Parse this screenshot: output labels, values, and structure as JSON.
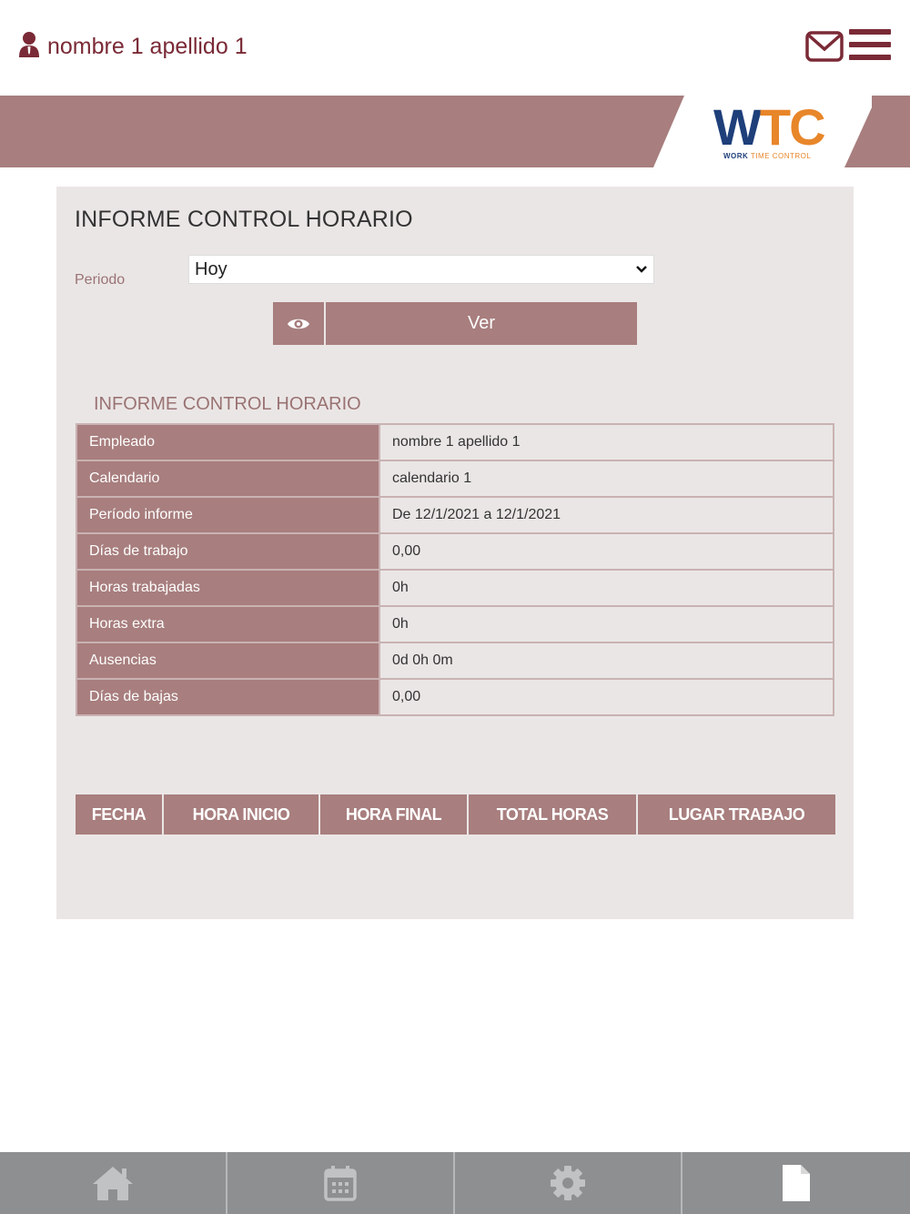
{
  "header": {
    "user_name": "nombre 1 apellido 1",
    "user_icon": "user-icon",
    "mail_icon": "mail-icon",
    "menu_icon": "hamburger-menu-icon"
  },
  "logo": {
    "letter_w": "W",
    "letters_tc": "TC",
    "tagline_bold": "WORK",
    "tagline_rest": "TIME CONTROL"
  },
  "colors": {
    "brand": "#a87e7e",
    "brand_dark": "#7a2a36",
    "panel_bg": "#ebe6e6",
    "logo_blue": "#1e3f7a",
    "logo_orange": "#e8862a",
    "nav_bg": "#8e8f91"
  },
  "form": {
    "title": "INFORME CONTROL HORARIO",
    "periodo_label": "Periodo",
    "periodo_value": "Hoy",
    "ver_label": "Ver",
    "eye_icon": "eye-icon"
  },
  "report": {
    "title": "INFORME CONTROL HORARIO",
    "rows": [
      {
        "label": "Empleado",
        "value": "nombre 1 apellido 1"
      },
      {
        "label": "Calendario",
        "value": "calendario 1"
      },
      {
        "label": "Período informe",
        "value": "De 12/1/2021 a 12/1/2021"
      },
      {
        "label": "Días de trabajo",
        "value": "0,00"
      },
      {
        "label": "Horas trabajadas",
        "value": "0h"
      },
      {
        "label": "Horas extra",
        "value": "0h"
      },
      {
        "label": "Ausencias",
        "value": "0d 0h 0m"
      },
      {
        "label": "Días de bajas",
        "value": "0,00"
      }
    ]
  },
  "records": {
    "columns": [
      "FECHA",
      "HORA INICIO",
      "HORA FINAL",
      "TOTAL HORAS",
      "LUGAR TRABAJO"
    ]
  },
  "bottom_nav": {
    "items": [
      "home-icon",
      "calendar-icon",
      "gear-icon",
      "document-icon"
    ],
    "active": "document-icon"
  }
}
